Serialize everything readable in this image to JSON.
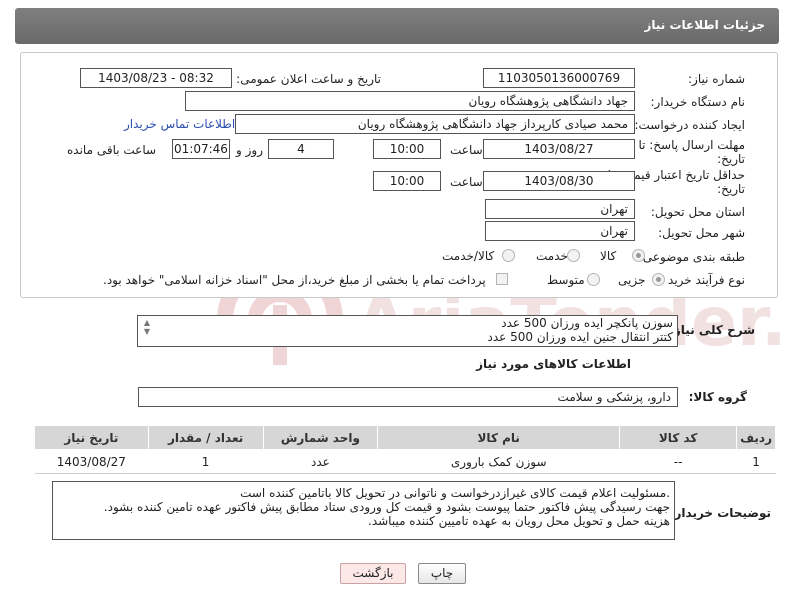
{
  "header": {
    "title": "جزئیات اطلاعات نیاز"
  },
  "form": {
    "need_number": {
      "label": "شماره نیاز:",
      "value": "1103050136000769"
    },
    "announce_datetime": {
      "label": "تاریخ و ساعت اعلان عمومی:",
      "value": "1403/08/23 - 08:32"
    },
    "buyer_org": {
      "label": "نام دستگاه خریدار:",
      "value": "جهاد دانشگاهی پژوهشگاه رویان"
    },
    "requester": {
      "label": "ایجاد کننده درخواست:",
      "value": "محمد صیادی کارپرداز جهاد دانشگاهی پژوهشگاه رویان"
    },
    "buyer_contact_link": "اطلاعات تماس خریدار",
    "reply_deadline": {
      "label_line1": "مهلت ارسال پاسخ: تا",
      "label_line2": "تاریخ:",
      "date": "1403/08/27",
      "time_label": "ساعت",
      "time": "10:00",
      "days": "4",
      "days_label": "روز و",
      "remaining": "01:07:46",
      "remaining_label": "ساعت باقی مانده"
    },
    "price_validity": {
      "label_line1": "حداقل تاریخ اعتبار قیمت: تا",
      "label_line2": "تاریخ:",
      "date": "1403/08/30",
      "time_label": "ساعت",
      "time": "10:00"
    },
    "province": {
      "label": "استان محل تحویل:",
      "value": "تهران"
    },
    "city": {
      "label": "شهر محل تحویل:",
      "value": "تهران"
    },
    "category": {
      "label": "طبقه بندی موضوعی:",
      "options": [
        "کالا",
        "خدمت",
        "کالا/خدمت"
      ],
      "selected": "کالا"
    },
    "process": {
      "label": "نوع فرآیند خرید :",
      "options": [
        "جزیی",
        "متوسط"
      ],
      "selected": "جزیی",
      "checkbox_label": "پرداخت تمام یا بخشی از مبلغ خرید،از محل \"اسناد خزانه اسلامی\" خواهد بود."
    }
  },
  "description": {
    "label": "شرح کلی نیاز:",
    "lines": [
      "سوزن پانکچر ایده ورزان 500 عدد",
      "کتتر انتقال جنین ایده ورزان 500 عدد"
    ]
  },
  "goods_section": {
    "title": "اطلاعات کالاهای مورد نیاز",
    "group_label": "گروه کالا:",
    "group_value": "دارو، پزشکی و سلامت"
  },
  "table": {
    "columns": [
      "ردیف",
      "کد کالا",
      "نام کالا",
      "واحد شمارش",
      "تعداد / مقدار",
      "تاریخ نیاز"
    ],
    "rows": [
      [
        "1",
        "--",
        "سوزن کمک باروری",
        "عدد",
        "1",
        "1403/08/27"
      ]
    ]
  },
  "buyer_notes": {
    "label": "توضیحات خریدار:",
    "lines": [
      ".مسئولیت اعلام قیمت کالای غیرازدرخواست و ناتوانی در تحویل کالا باتامین کننده است",
      "جهت رسیدگی پیش فاکتور حتما پیوست بشود و قیمت کل ورودی ستاد مطابق پیش فاکتور عهده تامین کننده بشود.",
      "هزینه حمل و تحویل محل رویان به عهده تامیین کننده میباشد."
    ]
  },
  "buttons": {
    "print": "چاپ",
    "back": "بازگشت"
  },
  "watermark": {
    "text": "AriaTender.neT",
    "color": "#e9c9c9"
  }
}
